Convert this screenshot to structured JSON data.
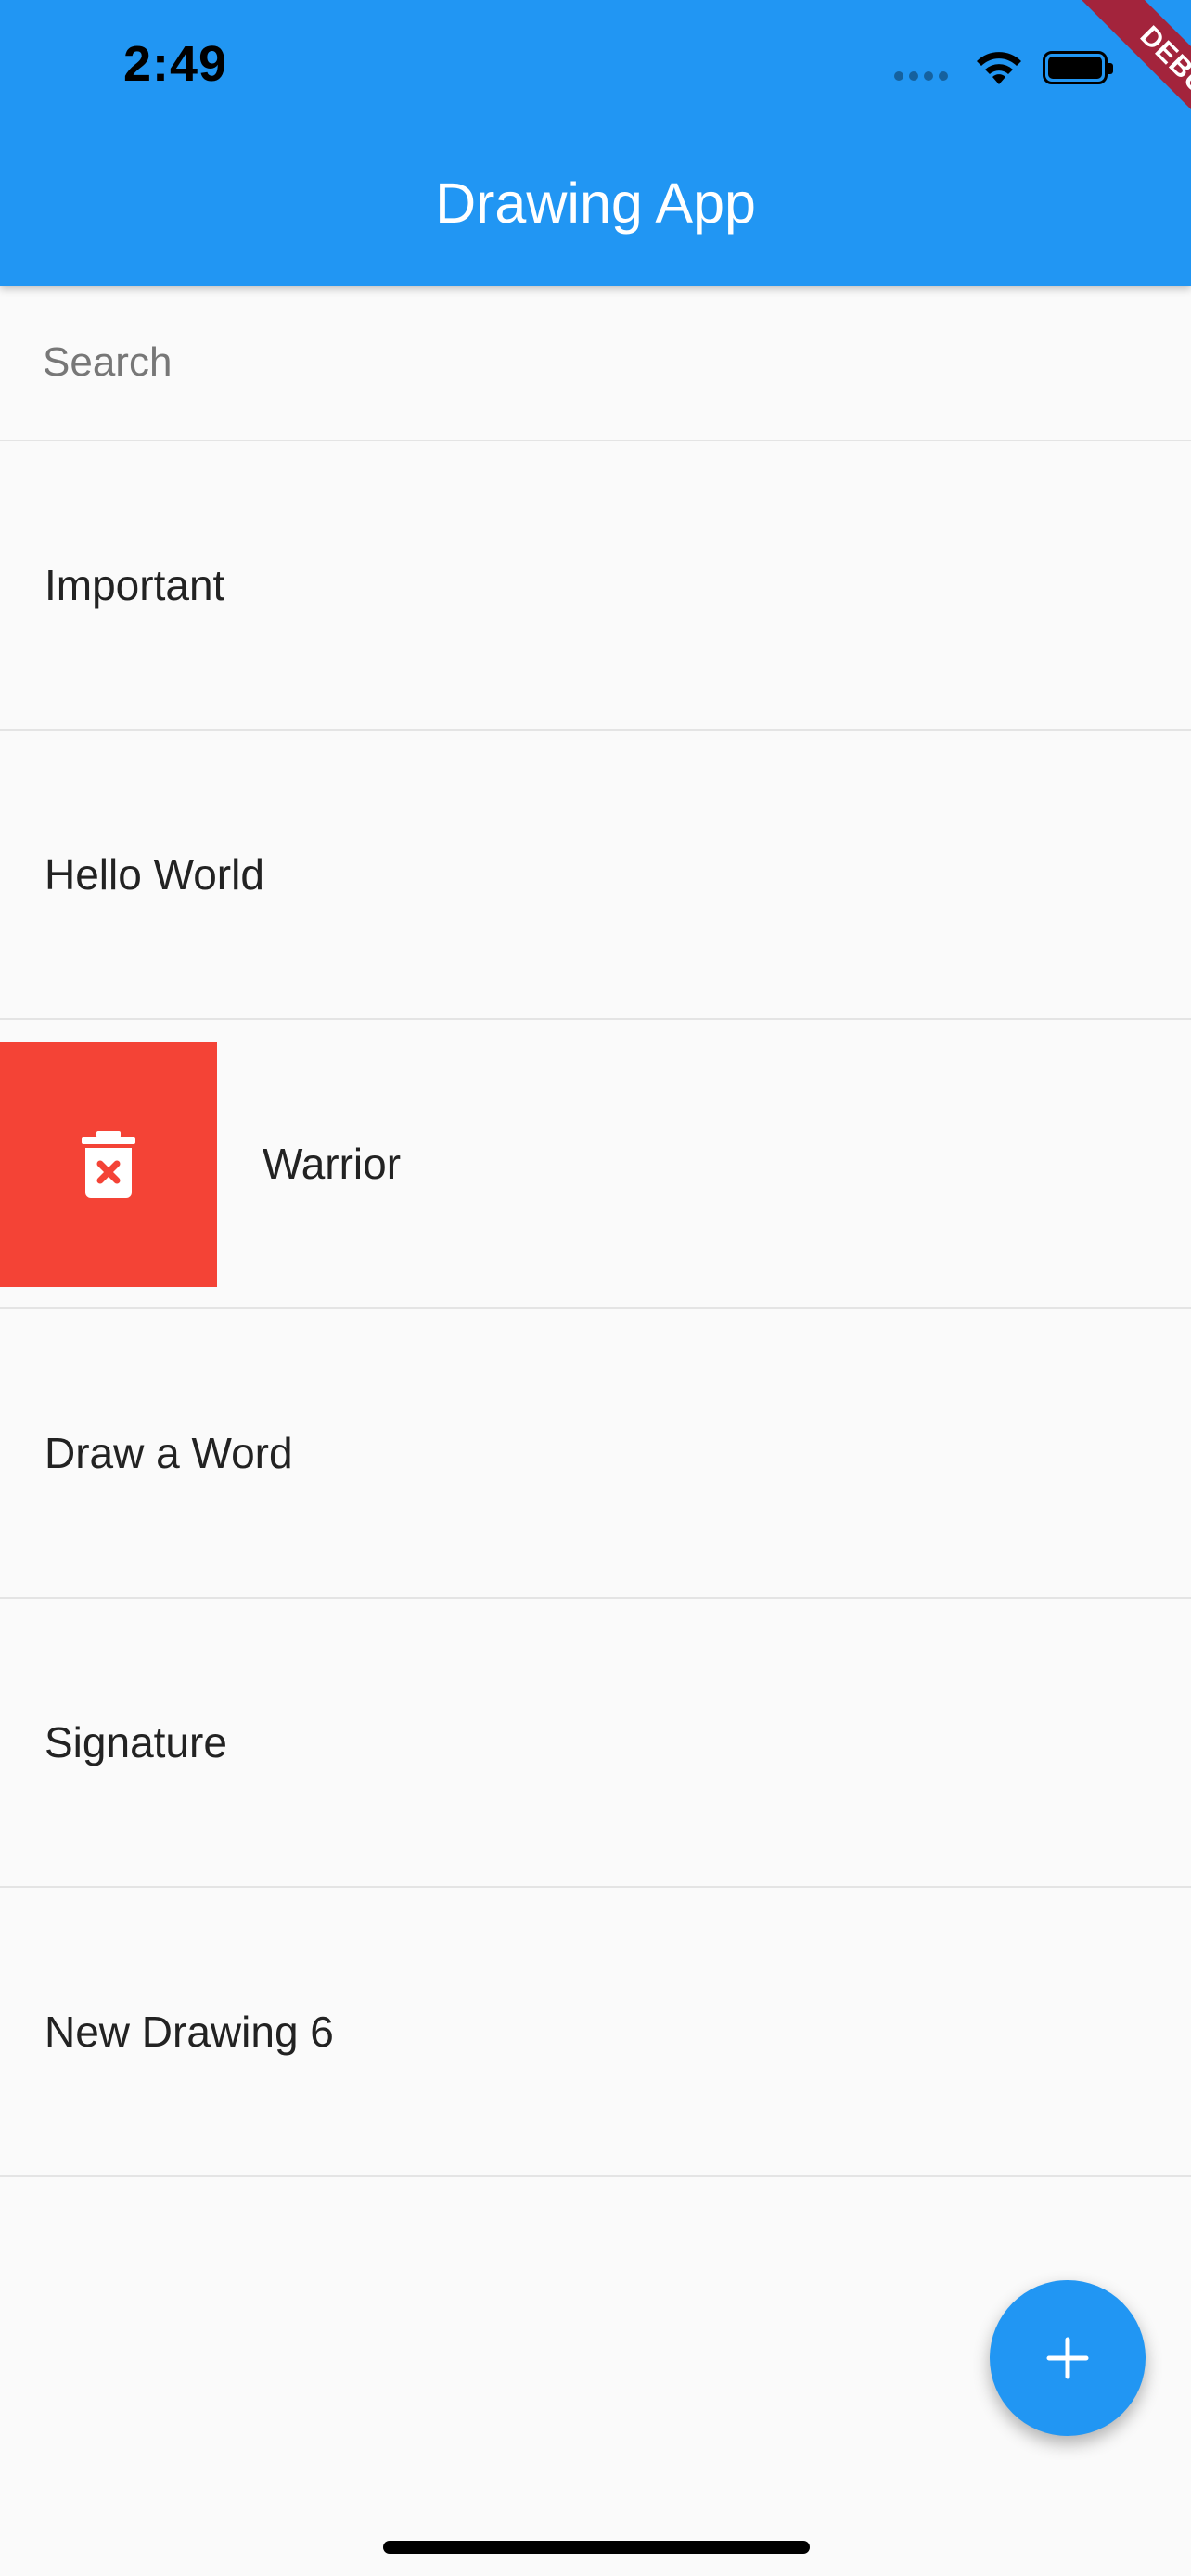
{
  "status_bar": {
    "time": "2:49"
  },
  "app_bar": {
    "title": "Drawing App"
  },
  "debug_banner": {
    "label": "DEBUG"
  },
  "search": {
    "placeholder": "Search",
    "value": ""
  },
  "drawings": [
    {
      "label": "Important"
    },
    {
      "label": "Hello World"
    },
    {
      "label": "Warrior"
    },
    {
      "label": "Draw a Word"
    },
    {
      "label": "Signature"
    },
    {
      "label": "New Drawing 6"
    }
  ],
  "delete_action": {
    "icon": "trash-delete-icon",
    "color": "#f44336"
  },
  "fab": {
    "icon": "plus-icon"
  },
  "colors": {
    "primary": "#2196f3",
    "delete": "#f44336",
    "debug": "#a3243c",
    "background": "#fafafa"
  }
}
